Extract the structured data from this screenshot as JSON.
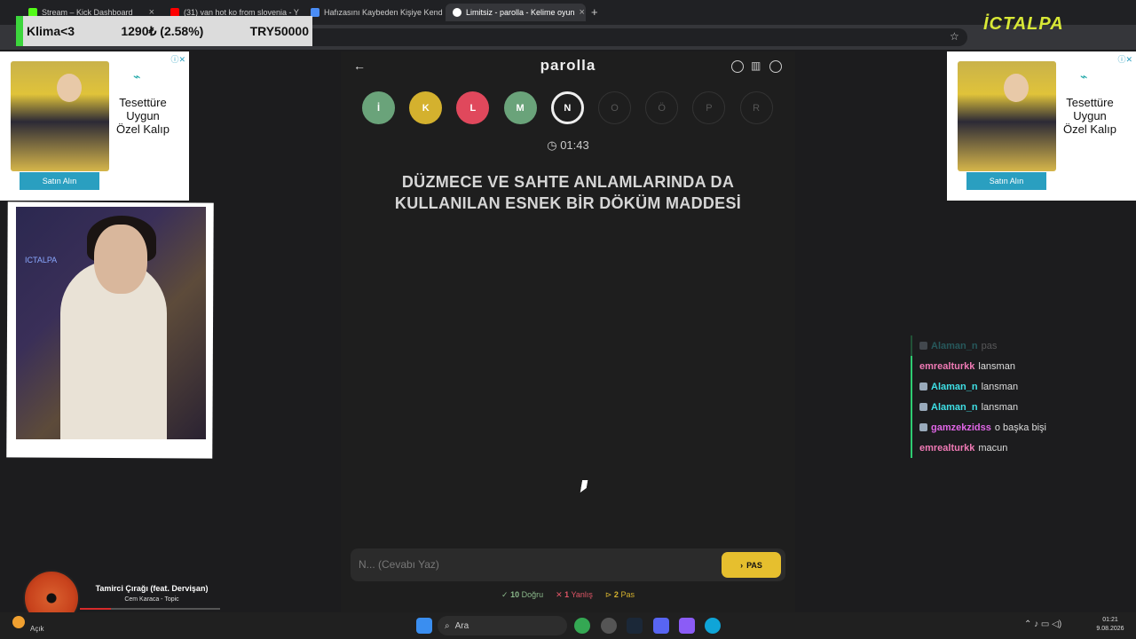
{
  "browser": {
    "tabs": [
      {
        "title": "Stream – Kick Dashboard",
        "fav_color": "#53fc18"
      },
      {
        "title": "(31) van hot ko from slovenia - Y",
        "fav_color": "#ff0000"
      },
      {
        "title": "Hafızasını Kaybeden Kişiye Kend",
        "fav_color": "#4a8df6"
      },
      {
        "title": "Limitsiz - parolla - Kelime oyun",
        "fav_color": "#ffffff"
      }
    ]
  },
  "overlay": {
    "donation_name": "Klima<3",
    "donation_value": "1290₺ (2.58%)",
    "donation_goal": "TRY50000",
    "logo": "İCTALPA"
  },
  "ad": {
    "text": "Tesettüre Uygun Özel Kalıp",
    "button": "Satın Alın",
    "info": "ⓘ✕"
  },
  "game": {
    "title": "parolla",
    "letters": [
      {
        "label": "İ",
        "state": "correct",
        "color": "#6aa37a"
      },
      {
        "label": "K",
        "state": "pass",
        "color": "#d4b12e"
      },
      {
        "label": "L",
        "state": "wrong",
        "color": "#e0485c"
      },
      {
        "label": "M",
        "state": "correct",
        "color": "#6aa37a"
      },
      {
        "label": "N",
        "state": "current",
        "color": "#1e1e1e"
      },
      {
        "label": "O",
        "state": "empty",
        "color": "#1e1e1e"
      },
      {
        "label": "Ö",
        "state": "empty",
        "color": "#1e1e1e"
      },
      {
        "label": "P",
        "state": "empty",
        "color": "#1e1e1e"
      },
      {
        "label": "R",
        "state": "empty",
        "color": "#1e1e1e"
      }
    ],
    "timer": "01:43",
    "question": "DÜZMECE VE SAHTE ANLAMLARINDA DA KULLANILAN ESNEK BİR DÖKÜM MADDESİ",
    "answer_placeholder": "N... (Cevabı Yaz)",
    "pass_button": "PAS",
    "stats": {
      "correct_count": "10",
      "correct_label": "Doğru",
      "wrong_count": "1",
      "wrong_label": "Yanlış",
      "pass_count": "2",
      "pass_label": "Pas"
    }
  },
  "chat": [
    {
      "user": "Alaman_n",
      "text": "pas",
      "color": "#3fe0e6",
      "dim": true
    },
    {
      "user": "emrealturkk",
      "text": "lansman",
      "color": "#f07ab5",
      "dim": false
    },
    {
      "user": "Alaman_n",
      "text": "lansman",
      "color": "#3fe0e6",
      "dim": false
    },
    {
      "user": "Alaman_n",
      "text": "lansman",
      "color": "#3fe0e6",
      "dim": false
    },
    {
      "user": "gamzekzidss",
      "text": "o başka bişi",
      "color": "#e066e6",
      "dim": false
    },
    {
      "user": "emrealturkk",
      "text": "macun",
      "color": "#f07ab5",
      "dim": false
    }
  ],
  "music": {
    "song": "Tamirci Çırağı (feat. Dervişan)",
    "artist": "Cem Karaca - Topic",
    "progress": 0.22
  },
  "taskbar": {
    "weather": "Açık",
    "search": "Ara",
    "time": "01:21",
    "date": "9.08.2026"
  }
}
